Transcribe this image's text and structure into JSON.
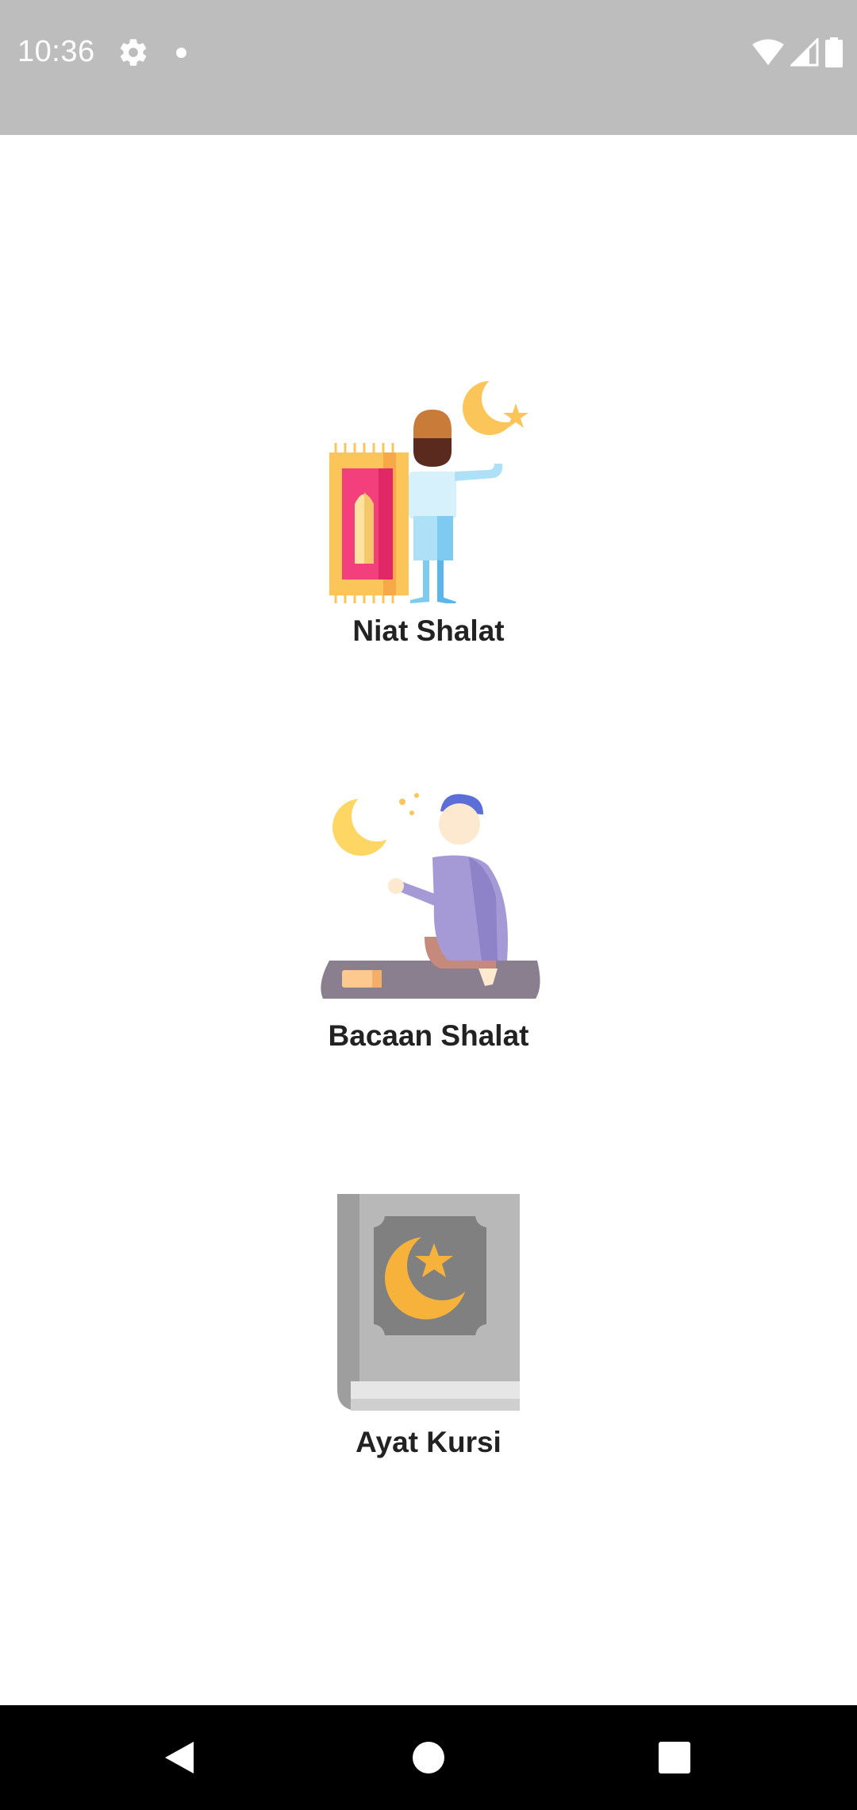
{
  "status_bar": {
    "time": "10:36",
    "icons": [
      "settings-gear-icon",
      "notification-dot-icon",
      "wifi-icon",
      "cell-signal-icon",
      "battery-icon"
    ]
  },
  "menu": {
    "items": [
      {
        "label": "Niat Shalat",
        "icon": "standing-man-prayer-rug-icon"
      },
      {
        "label": "Bacaan Shalat",
        "icon": "sitting-praying-man-icon"
      },
      {
        "label": "Ayat Kursi",
        "icon": "quran-book-icon"
      }
    ]
  },
  "nav_bar": {
    "buttons": [
      "back-triangle-icon",
      "home-circle-icon",
      "recents-square-icon"
    ]
  }
}
